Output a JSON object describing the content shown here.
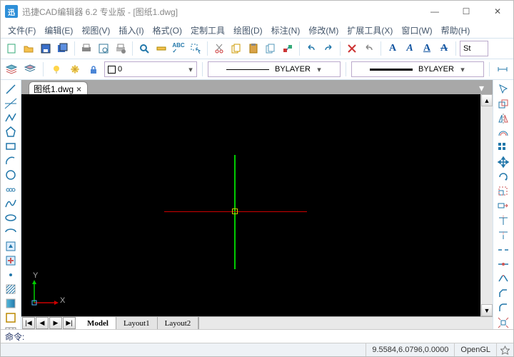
{
  "title": "迅捷CAD编辑器 6.2 专业版  - [图纸1.dwg]",
  "logo": "迅",
  "menus": [
    "文件(F)",
    "编辑(E)",
    "视图(V)",
    "插入(I)",
    "格式(O)",
    "定制工具",
    "绘图(D)",
    "标注(N)",
    "修改(M)",
    "扩展工具(X)",
    "窗口(W)",
    "帮助(H)"
  ],
  "doc": {
    "name": "图纸1.dwg"
  },
  "layer": {
    "name": "0"
  },
  "linetype1": "BYLAYER",
  "linetype2": "BYLAYER",
  "style_field": "St",
  "sheets": {
    "nav": [
      "|◀",
      "◀",
      "▶",
      "▶|"
    ],
    "tabs": [
      "Model",
      "Layout1",
      "Layout2"
    ],
    "active": 0
  },
  "cmd_prompt": "命令:",
  "status": {
    "coords": "9.5584,6.0796,0.0000",
    "renderer": "OpenGL"
  },
  "ucs": {
    "x": "X",
    "y": "Y"
  }
}
